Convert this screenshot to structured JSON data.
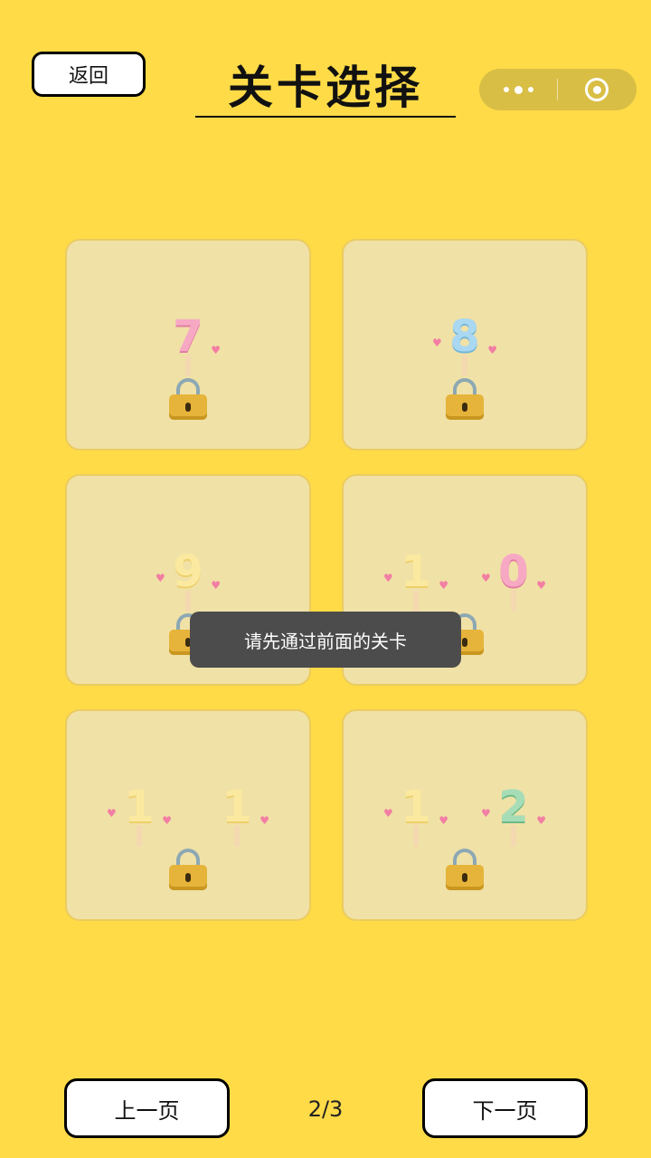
{
  "header": {
    "back_label": "返回",
    "title": "关卡选择"
  },
  "levels": [
    {
      "number": "7",
      "locked": true,
      "digits": [
        "7"
      ]
    },
    {
      "number": "8",
      "locked": true,
      "digits": [
        "8"
      ]
    },
    {
      "number": "9",
      "locked": true,
      "digits": [
        "9"
      ]
    },
    {
      "number": "10",
      "locked": true,
      "digits": [
        "1",
        "0"
      ]
    },
    {
      "number": "11",
      "locked": true,
      "digits": [
        "1",
        "1"
      ]
    },
    {
      "number": "12",
      "locked": true,
      "digits": [
        "1",
        "2"
      ]
    }
  ],
  "toast": "请先通过前面的关卡",
  "footer": {
    "prev_label": "上一页",
    "page": "2/3",
    "next_label": "下一页"
  },
  "colors": {
    "background": "#FFDB47",
    "card": "#F0E1A7",
    "lock": "#E6B43A"
  },
  "icons": {
    "more": "more-dots-icon",
    "close": "capsule-close-icon",
    "lock": "lock-icon",
    "heart": "heart-icon"
  }
}
